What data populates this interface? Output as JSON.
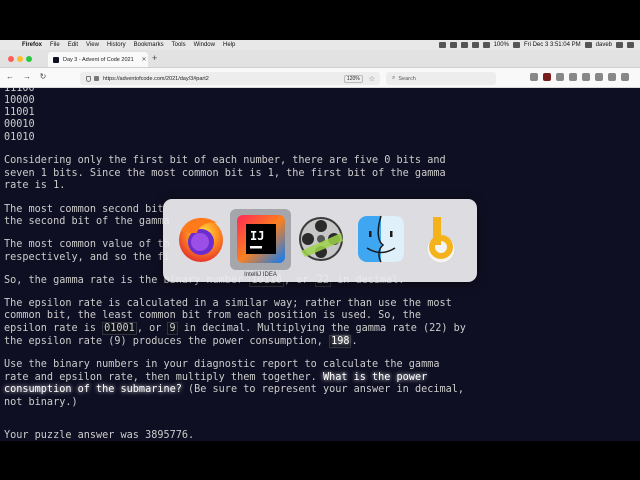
{
  "menubar": {
    "app_name": "Firefox",
    "menus": [
      "File",
      "Edit",
      "View",
      "History",
      "Bookmarks",
      "Tools",
      "Window",
      "Help"
    ],
    "battery": "100%",
    "clock": "Fri Dec 3  3:51:04 PM",
    "user": "daveb"
  },
  "browser": {
    "tab_title": "Day 3 - Advent of Code 2021",
    "url": "https://adventofcode.com/2021/day/3#part2",
    "zoom": "120%",
    "search_placeholder": "Search"
  },
  "content": {
    "l0": "11100",
    "l1": "10000",
    "l2": "11001",
    "l3": "00010",
    "l4": "01010",
    "p1a": "Considering only the first bit of each number, there are five 0 bits and",
    "p1b": "seven 1 bits. Since the most common bit is 1, the first bit of the gamma",
    "p1c": "rate is 1.",
    "p2a": "The most common second bit",
    "p2b": "the second bit of the gamma",
    "p3a": "The most common value of th",
    "p3b": "respectively, and so the fi",
    "p4a": "So, the gamma rate is the binary number ",
    "p4code": "10110",
    "p4b": ", or ",
    "p4num": "22",
    "p4c": " in decimal.",
    "p5a_pre": "The epsilon rate is calculated in a similar way; rather than use the most",
    "p5b": "common bit, the least common bit from each position is used. So, the",
    "p5c_pre": "epsilon rate is ",
    "p5c_code": "01001",
    "p5c_mid": ", or ",
    "p5c_num": "9",
    "p5c_post": " in decimal. Multiplying the gamma rate (22) by",
    "p5d_pre": "the epsilon rate (9) produces the power consumption, ",
    "p5d_code": "198",
    "p5d_post": ".",
    "p6a": "Use the binary numbers in your diagnostic report to calculate the gamma",
    "p6b_pre": "rate and epsilon rate, then multiply them together. ",
    "p6b_em": "What is the power",
    "p6c_em": "consumption of the submarine?",
    "p6c_post": " (Be sure to represent your answer in decimal,",
    "p6d": "not binary.)",
    "answer_pre": "Your puzzle answer was ",
    "answer": "3895776",
    "answer_post": "."
  },
  "switcher": {
    "apps": [
      "Firefox",
      "IntelliJ IDEA",
      "Final Cut / Motion",
      "Finder",
      "Hyperdock"
    ],
    "selected_label": "IntelliJ IDEA"
  }
}
